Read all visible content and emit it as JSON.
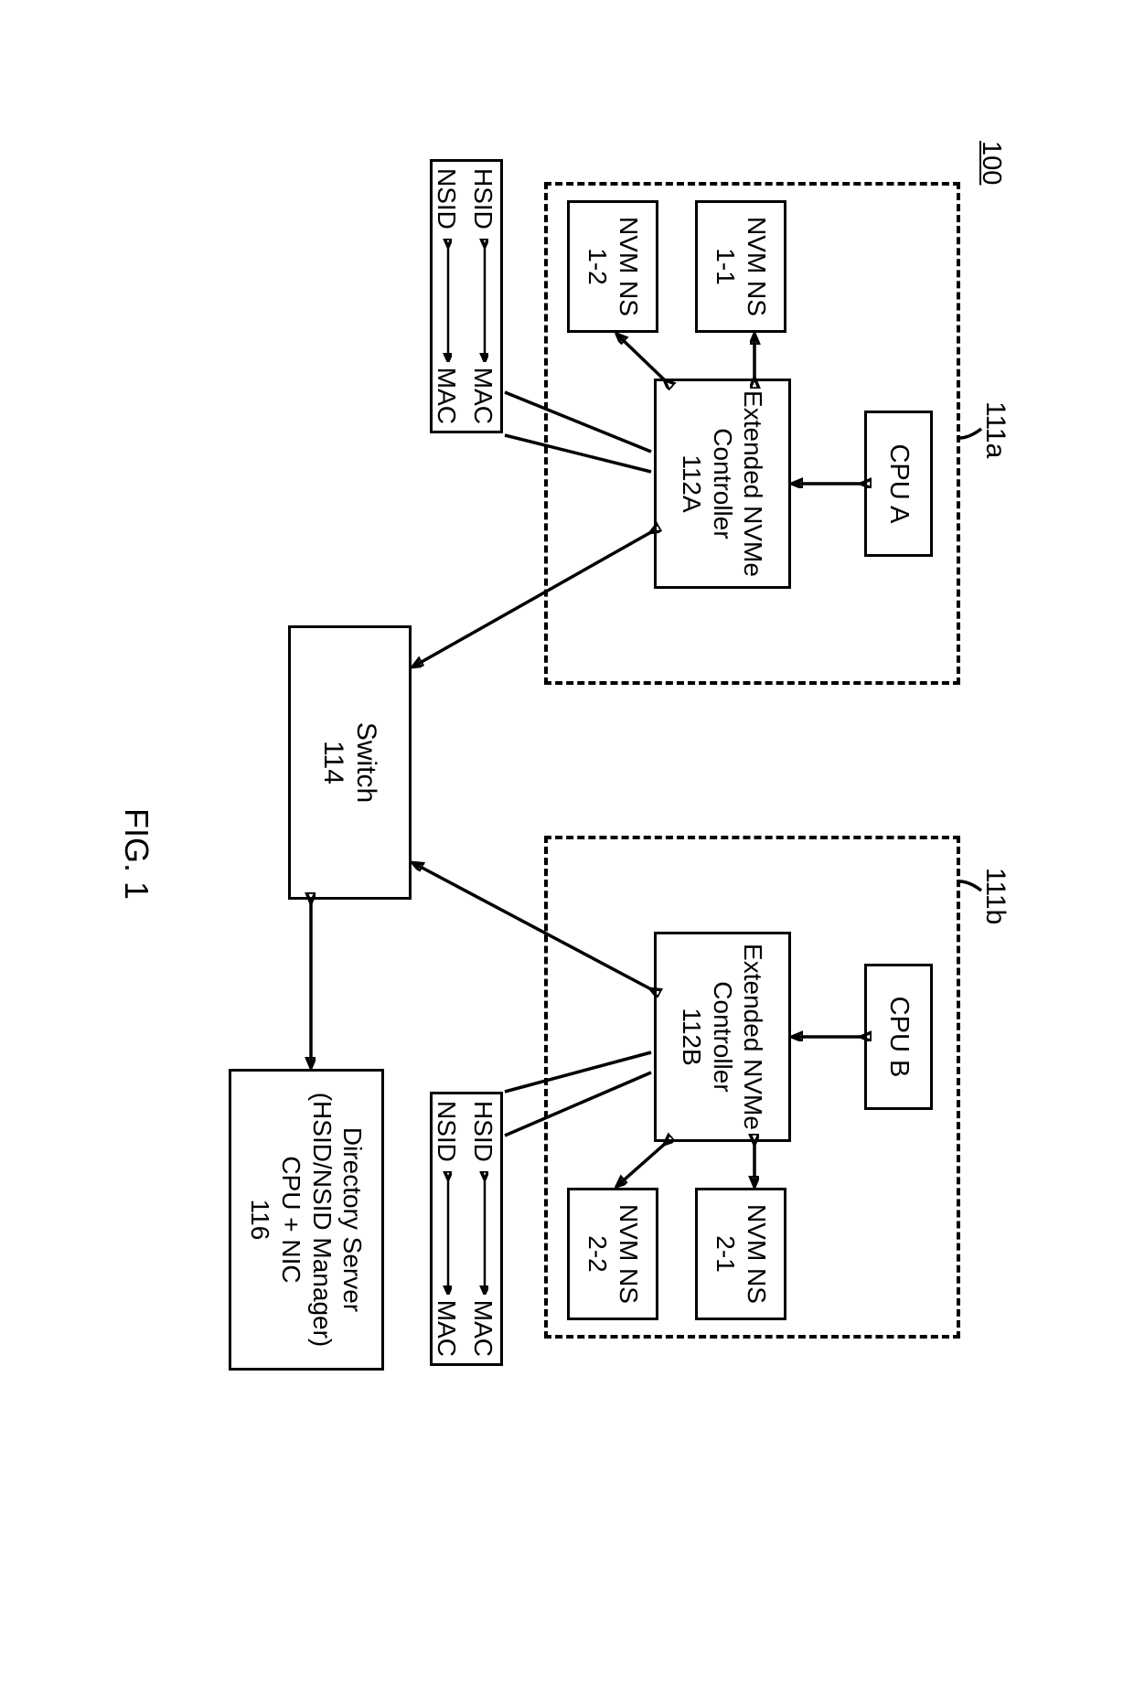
{
  "figure": {
    "ref": "100",
    "caption": "FIG. 1"
  },
  "hostA": {
    "lead": "111a",
    "cpu": "CPU A",
    "controller_l1": "Extended NVMe",
    "controller_l2": "Controller",
    "controller_l3": "112A",
    "ns1": "NVM NS 1-1",
    "ns2": "NVM NS 1-2"
  },
  "hostB": {
    "lead": "111b",
    "cpu": "CPU B",
    "controller_l1": "Extended NVMe",
    "controller_l2": "Controller",
    "controller_l3": "112B",
    "ns1": "NVM NS 2-1",
    "ns2": "NVM NS 2-2"
  },
  "switch": {
    "l1": "Switch",
    "l2": "114"
  },
  "directory": {
    "l1": "Directory Server",
    "l2": "(HSID/NSID Manager)",
    "l3": "CPU + NIC",
    "l4": "116"
  },
  "map": {
    "hsid": "HSID",
    "nsid": "NSID",
    "mac": "MAC"
  }
}
